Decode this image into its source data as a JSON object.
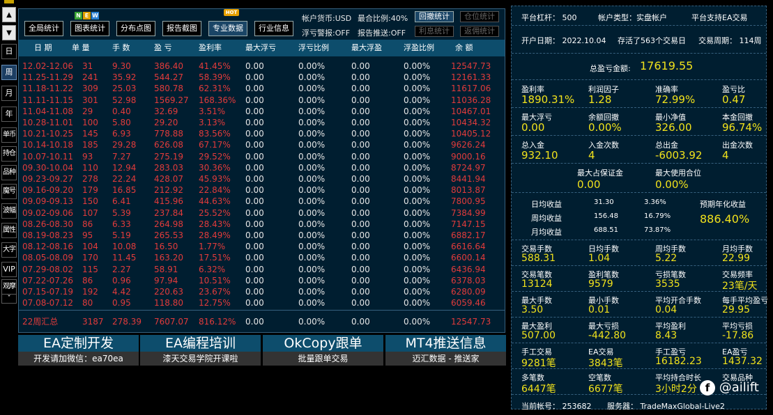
{
  "left_nav": {
    "up": "▲",
    "down": "▼",
    "items": [
      {
        "label": "日",
        "name": "nav-day"
      },
      {
        "label": "周",
        "name": "nav-week"
      },
      {
        "label": "月",
        "name": "nav-month"
      },
      {
        "label": "年",
        "name": "nav-year"
      },
      {
        "label": "单币",
        "name": "nav-single-currency"
      },
      {
        "label": "持仓",
        "name": "nav-positions"
      },
      {
        "label": "品种",
        "name": "nav-symbols"
      },
      {
        "label": "魔号",
        "name": "nav-magic"
      },
      {
        "label": "波幅",
        "name": "nav-volatility"
      },
      {
        "label": "属性",
        "name": "nav-attributes"
      },
      {
        "label": "大字",
        "name": "nav-large-font"
      },
      {
        "label": "VIP",
        "name": "nav-vip"
      },
      {
        "label": "观摩",
        "name": "nav-observe"
      },
      {
        "label": "ˇ",
        "name": "nav-more"
      }
    ]
  },
  "toolbar": {
    "buttons": [
      {
        "label": "全局统计",
        "name": "global-stats-button"
      },
      {
        "label": "图表统计",
        "name": "chart-stats-button"
      },
      {
        "label": "分布点图",
        "name": "distribution-chart-button"
      },
      {
        "label": "报告截图",
        "name": "report-screenshot-button"
      },
      {
        "label": "专业数据",
        "name": "pro-data-button"
      },
      {
        "label": "行业信息",
        "name": "industry-info-button"
      }
    ],
    "new_badge": [
      "N",
      "E",
      "W"
    ],
    "hot_badge": "HOT",
    "account_currency": "帐户货币:USD",
    "max_ratio": "最合比例:40%",
    "float_alert": "浮亏警报:OFF",
    "report_push": "报告推送:OFF",
    "stat_buttons": [
      {
        "label": "回撤统计",
        "name": "drawdown-stats-button"
      },
      {
        "label": "仓位统计",
        "name": "position-stats-button"
      },
      {
        "label": "利息统计",
        "name": "interest-stats-button"
      },
      {
        "label": "返佣统计",
        "name": "rebate-stats-button"
      }
    ]
  },
  "table": {
    "headers": [
      "日 期",
      "单 量",
      "手 数",
      "盈 亏",
      "盈利率",
      "最大浮亏",
      "浮亏比例",
      "最大浮盈",
      "浮盈比例",
      "余 额"
    ],
    "rows": [
      [
        "12.02-12.06",
        "31",
        "9.30",
        "386.40",
        "41.45%",
        "0.00",
        "0.00%",
        "0.00",
        "0.00%",
        "12547.73"
      ],
      [
        "11.25-11.29",
        "241",
        "35.92",
        "544.27",
        "58.39%",
        "0.00",
        "0.00%",
        "0.00",
        "0.00%",
        "12161.33"
      ],
      [
        "11.18-11.22",
        "309",
        "25.03",
        "580.78",
        "62.31%",
        "0.00",
        "0.00%",
        "0.00",
        "0.00%",
        "11617.06"
      ],
      [
        "11.11-11.15",
        "301",
        "52.98",
        "1569.27",
        "168.36%",
        "0.00",
        "0.00%",
        "0.00",
        "0.00%",
        "11036.28"
      ],
      [
        "11.04-11.08",
        "29",
        "0.40",
        "32.69",
        "3.51%",
        "0.00",
        "0.00%",
        "0.00",
        "0.00%",
        "10467.01"
      ],
      [
        "10.28-11.01",
        "100",
        "5.80",
        "29.20",
        "3.13%",
        "0.00",
        "0.00%",
        "0.00",
        "0.00%",
        "10434.32"
      ],
      [
        "10.21-10.25",
        "145",
        "6.93",
        "778.88",
        "83.56%",
        "0.00",
        "0.00%",
        "0.00",
        "0.00%",
        "10405.12"
      ],
      [
        "10.14-10.18",
        "185",
        "29.28",
        "626.08",
        "67.17%",
        "0.00",
        "0.00%",
        "0.00",
        "0.00%",
        "9626.24"
      ],
      [
        "10.07-10.11",
        "93",
        "7.27",
        "275.19",
        "29.52%",
        "0.00",
        "0.00%",
        "0.00",
        "0.00%",
        "9000.16"
      ],
      [
        "09.30-10.04",
        "110",
        "12.94",
        "283.03",
        "30.36%",
        "0.00",
        "0.00%",
        "0.00",
        "0.00%",
        "8724.97"
      ],
      [
        "09.23-09.27",
        "278",
        "22.24",
        "428.07",
        "45.93%",
        "0.00",
        "0.00%",
        "0.00",
        "0.00%",
        "8441.94"
      ],
      [
        "09.16-09.20",
        "179",
        "16.85",
        "212.92",
        "22.84%",
        "0.00",
        "0.00%",
        "0.00",
        "0.00%",
        "8013.87"
      ],
      [
        "09.09-09.13",
        "150",
        "6.41",
        "415.96",
        "44.63%",
        "0.00",
        "0.00%",
        "0.00",
        "0.00%",
        "7800.95"
      ],
      [
        "09.02-09.06",
        "107",
        "5.39",
        "237.84",
        "25.52%",
        "0.00",
        "0.00%",
        "0.00",
        "0.00%",
        "7384.99"
      ],
      [
        "08.26-08.30",
        "86",
        "6.33",
        "264.98",
        "28.43%",
        "0.00",
        "0.00%",
        "0.00",
        "0.00%",
        "7147.15"
      ],
      [
        "08.19-08.23",
        "95",
        "5.19",
        "265.53",
        "28.49%",
        "0.00",
        "0.00%",
        "0.00",
        "0.00%",
        "6882.17"
      ],
      [
        "08.12-08.16",
        "104",
        "10.08",
        "16.50",
        "1.77%",
        "0.00",
        "0.00%",
        "0.00",
        "0.00%",
        "6616.64"
      ],
      [
        "08.05-08.09",
        "170",
        "11.45",
        "163.20",
        "17.51%",
        "0.00",
        "0.00%",
        "0.00",
        "0.00%",
        "6600.14"
      ],
      [
        "07.29-08.02",
        "115",
        "2.27",
        "58.91",
        "6.32%",
        "0.00",
        "0.00%",
        "0.00",
        "0.00%",
        "6436.94"
      ],
      [
        "07.22-07.26",
        "86",
        "0.96",
        "97.94",
        "10.51%",
        "0.00",
        "0.00%",
        "0.00",
        "0.00%",
        "6378.03"
      ],
      [
        "07.15-07.19",
        "192",
        "4.42",
        "220.63",
        "23.67%",
        "0.00",
        "0.00%",
        "0.00",
        "0.00%",
        "6280.09"
      ],
      [
        "07.08-07.12",
        "80",
        "0.95",
        "118.80",
        "12.75%",
        "0.00",
        "0.00%",
        "0.00",
        "0.00%",
        "6059.46"
      ]
    ],
    "summary": [
      "22周汇总",
      "3187",
      "278.39",
      "7607.07",
      "816.12%",
      "0.00",
      "0.00%",
      "0.00",
      "0.00%",
      "12547.73"
    ]
  },
  "ads": [
    {
      "big": "EA定制开发",
      "small": "开发请加微信：ea70ea",
      "name": "ad-ea-custom"
    },
    {
      "big": "EA编程培训",
      "small": "漆天交易学院开课啦",
      "name": "ad-ea-training"
    },
    {
      "big": "OkCopy跟单",
      "small": "批量跟单交易",
      "name": "ad-okcopy"
    },
    {
      "big": "MT4推送信息",
      "small": "迈汇数据 - 推送家",
      "name": "ad-mt4-push"
    }
  ],
  "right": {
    "platform_leverage": "平台杠杆： 500",
    "account_type": "帐户类型：实盘帐户",
    "ea_support": "平台支持EA交易",
    "open_date": "开户日期： 2022.10.04",
    "survived": "存活了563个交易日",
    "period": "交易周期： 114周",
    "total_pl_label": "总盈亏金额:",
    "total_pl_value": "17619.55",
    "grid1": [
      {
        "label": "盈利率",
        "value": "1890.31%"
      },
      {
        "label": "利润因子",
        "value": "1.28"
      },
      {
        "label": "准确率",
        "value": "72.99%"
      },
      {
        "label": "盈亏比",
        "value": "0.47"
      },
      {
        "label": "最大浮亏",
        "value": "0.00"
      },
      {
        "label": "余额回撤",
        "value": "0.00%"
      },
      {
        "label": "最小净值",
        "value": "326.00"
      },
      {
        "label": "本金回撤",
        "value": "96.74%"
      },
      {
        "label": "总入金",
        "value": "932.10"
      },
      {
        "label": "入金次数",
        "value": "4"
      },
      {
        "label": "总出金",
        "value": "-6003.92"
      },
      {
        "label": "出金次数",
        "value": "4"
      }
    ],
    "margin": [
      {
        "label": "最大占保证金",
        "value": "0.00"
      },
      {
        "label": "最大使用合位",
        "value": "0.00%"
      }
    ],
    "avg": [
      {
        "label": "日均收益",
        "amount": "31.30",
        "pct": "3.36%"
      },
      {
        "label": "周均收益",
        "amount": "156.48",
        "pct": "16.79%"
      },
      {
        "label": "月均收益",
        "amount": "688.51",
        "pct": "73.87%"
      }
    ],
    "annual_label": "预期年化收益",
    "annual_value": "886.40%",
    "grid2": [
      {
        "label": "交易手数",
        "value": "588.31"
      },
      {
        "label": "日均手数",
        "value": "1.04"
      },
      {
        "label": "周均手数",
        "value": "5.22"
      },
      {
        "label": "月均手数",
        "value": "22.99"
      },
      {
        "label": "交易笔数",
        "value": "13124"
      },
      {
        "label": "盈利笔数",
        "value": "9579"
      },
      {
        "label": "亏损笔数",
        "value": "3535"
      },
      {
        "label": "交易频率",
        "value": "23笔/天"
      },
      {
        "label": "最大手数",
        "value": "3.50"
      },
      {
        "label": "最小手数",
        "value": "0.01"
      },
      {
        "label": "平均开合手数",
        "value": "0.04"
      },
      {
        "label": "每手平均盈亏",
        "value": "29.95"
      },
      {
        "label": "最大盈利",
        "value": "507.00"
      },
      {
        "label": "最大亏损",
        "value": "-442.80"
      },
      {
        "label": "平均盈利",
        "value": "8.43"
      },
      {
        "label": "平均亏损",
        "value": "-17.86"
      },
      {
        "label": "手工交易",
        "value": "9281笔"
      },
      {
        "label": "EA交易",
        "value": "3843笔"
      },
      {
        "label": "手工盈亏",
        "value": "16182.23"
      },
      {
        "label": "EA盈亏",
        "value": "1437.32"
      },
      {
        "label": "多笔数",
        "value": "6447笔"
      },
      {
        "label": "空笔数",
        "value": "6677笔"
      },
      {
        "label": "平均持合时长",
        "value": "3小时2分"
      },
      {
        "label": "交易品种",
        "value": ""
      }
    ],
    "account_no": "当前帐号： 253682",
    "server": "服务器： TradeMaxGlobal-Live2"
  },
  "watermark": "@ailift",
  "colors": {
    "panel": "#001e30",
    "header": "#0d4d6c",
    "red": "#e23b3b",
    "yellow": "#f1e21c",
    "border": "#36607e"
  }
}
